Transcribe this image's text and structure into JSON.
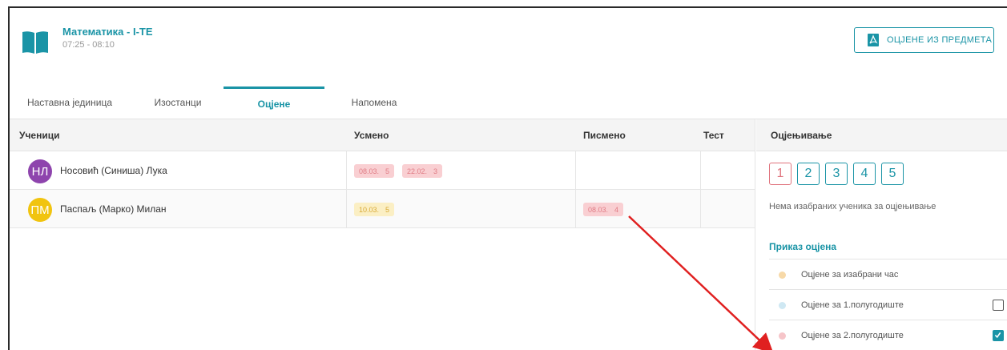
{
  "header": {
    "subject": "Математика - I-ТЕ",
    "time": "07:25 - 08:10",
    "pdf_button": "ОЦЈЕНЕ ИЗ ПРЕДМЕТА"
  },
  "tabs": [
    {
      "label": "Наставна јединица",
      "active": false
    },
    {
      "label": "Изостанци",
      "active": false
    },
    {
      "label": "Оцјене",
      "active": true
    },
    {
      "label": "Напомена",
      "active": false
    }
  ],
  "table": {
    "columns": [
      "Ученици",
      "Усмено",
      "Писмено",
      "Тест"
    ],
    "rows": [
      {
        "initials": "НЛ",
        "name": "Носовић (Синиша) Лука",
        "avatar_color": "#8e44ad",
        "usmeno": [
          {
            "date": "08.03.",
            "grade": "5",
            "color": "red"
          },
          {
            "date": "22.02.",
            "grade": "3",
            "color": "red"
          }
        ],
        "pismeno": [],
        "test": []
      },
      {
        "initials": "ПМ",
        "name": "Паспаљ (Марко) Милан",
        "avatar_color": "#f1c40f",
        "usmeno": [
          {
            "date": "10.03.",
            "grade": "5",
            "color": "yellow"
          }
        ],
        "pismeno": [
          {
            "date": "08.03.",
            "grade": "4",
            "color": "red"
          }
        ],
        "test": []
      }
    ]
  },
  "sidebar": {
    "title": "Оцјењивање",
    "grade_buttons": [
      "1",
      "2",
      "3",
      "4",
      "5"
    ],
    "no_students": "Нема изабраних ученика за оцјењивање",
    "display_title": "Приказ оцјена",
    "legend": [
      {
        "label": "Оцјене за изабрани час",
        "dot_color": "#f7d9a8",
        "checkbox": "none"
      },
      {
        "label": "Оцјене за 1.полугодиште",
        "dot_color": "#cfe8f3",
        "checkbox": "unchecked"
      },
      {
        "label": "Оцјене за 2.полугодиште",
        "dot_color": "#f6c5c9",
        "checkbox": "checked"
      }
    ]
  },
  "colors": {
    "accent": "#1a94a6",
    "arrow": "#e02020"
  }
}
